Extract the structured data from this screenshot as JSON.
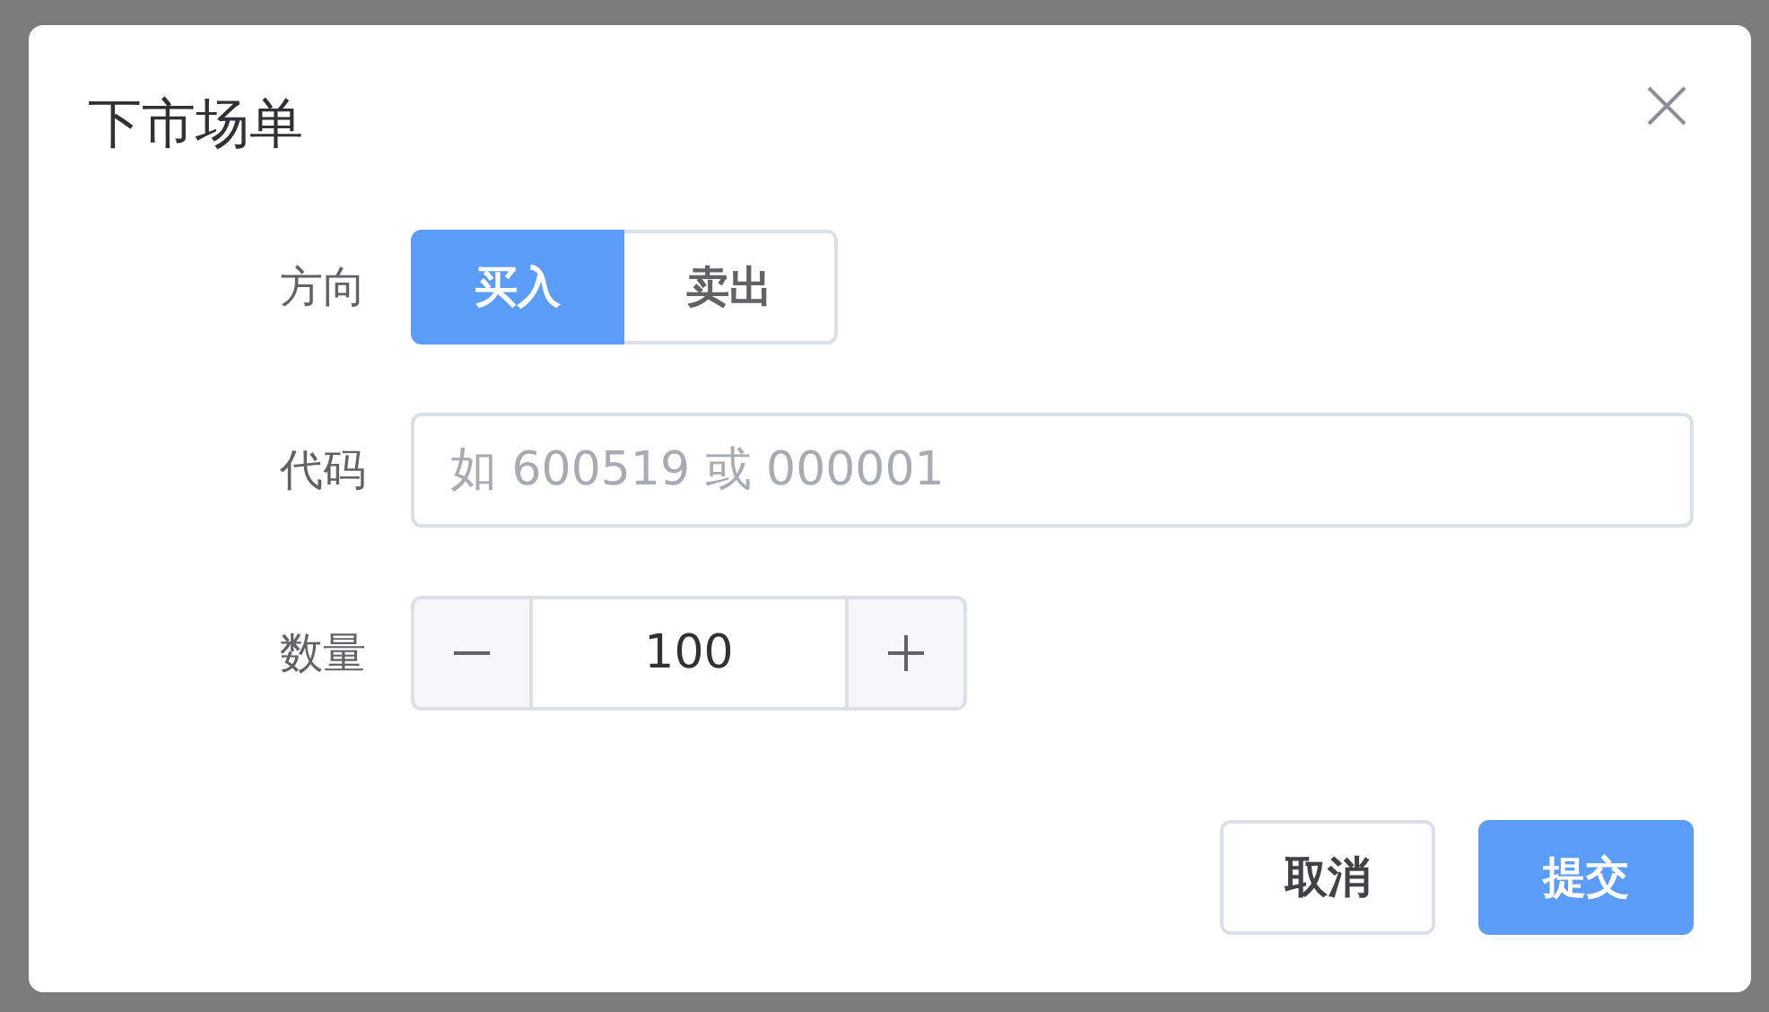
{
  "dialog": {
    "title": "下市场单",
    "direction": {
      "label": "方向",
      "options": [
        {
          "label": "买入",
          "selected": true
        },
        {
          "label": "卖出",
          "selected": false
        }
      ]
    },
    "code": {
      "label": "代码",
      "placeholder": "如 600519 或 000001"
    },
    "quantity": {
      "label": "数量",
      "value": "100"
    },
    "buttons": [
      {
        "label": "取消",
        "kind": "secondary"
      },
      {
        "label": "提交",
        "kind": "primary"
      }
    ]
  }
}
